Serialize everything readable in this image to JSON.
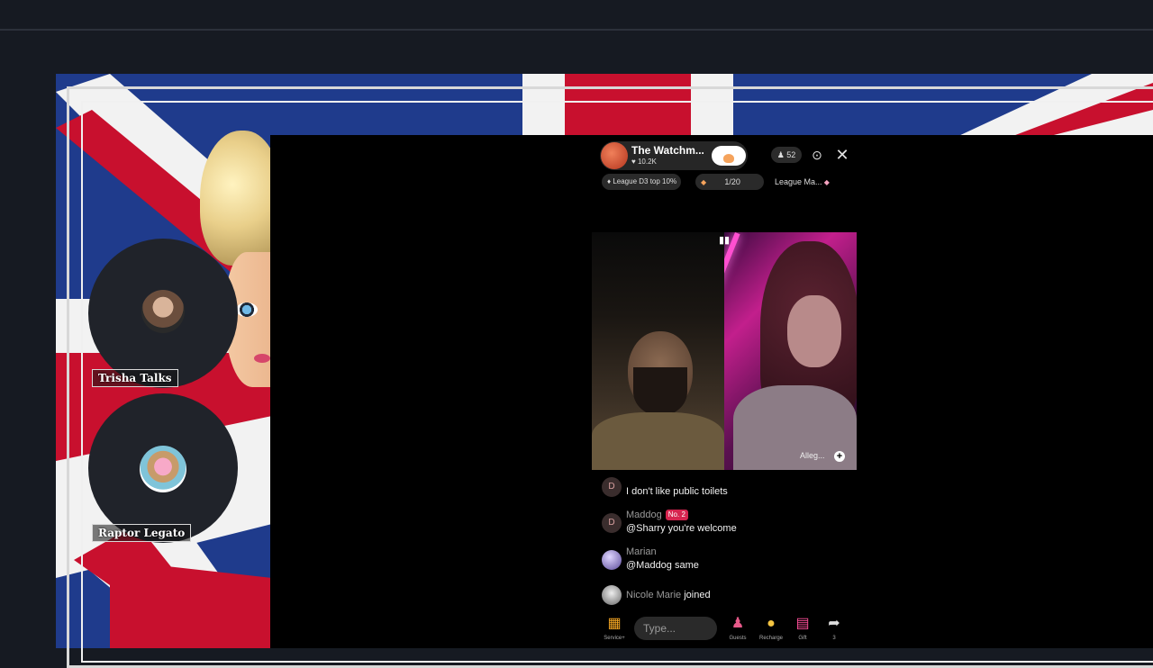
{
  "stream": {
    "host_name": "The Watchm...",
    "host_likes": "10.2K",
    "viewer_count": "52",
    "league_badge": "League D3 top 10%",
    "progress": "1/20",
    "league_match": "League Ma..."
  },
  "overlay": {
    "guest1_name": "Trisha Talks",
    "guest2_name": "Raptor Legato"
  },
  "tiles": {
    "right_label": "Alleg..."
  },
  "chat": [
    {
      "initial": "D",
      "user": "",
      "message": "I don't like public toilets",
      "badge": ""
    },
    {
      "initial": "D",
      "user": "Maddog",
      "message": "@Sharry you're welcome",
      "badge": "No. 2"
    },
    {
      "initial": "",
      "user": "Marian",
      "message": "@Maddog same",
      "badge": ""
    },
    {
      "initial": "",
      "user": "Nicole Marie",
      "message": "joined",
      "badge": ""
    }
  ],
  "bottom_bar": {
    "input_placeholder": "Type...",
    "labels": [
      "Service+",
      "Guests",
      "Recharge",
      "Gift",
      "3"
    ]
  },
  "colors": {
    "flag_red": "#c8102e",
    "flag_blue": "#1f3b8c",
    "accent_pink": "#d6244f",
    "follow_orange": "#f5a35c"
  }
}
